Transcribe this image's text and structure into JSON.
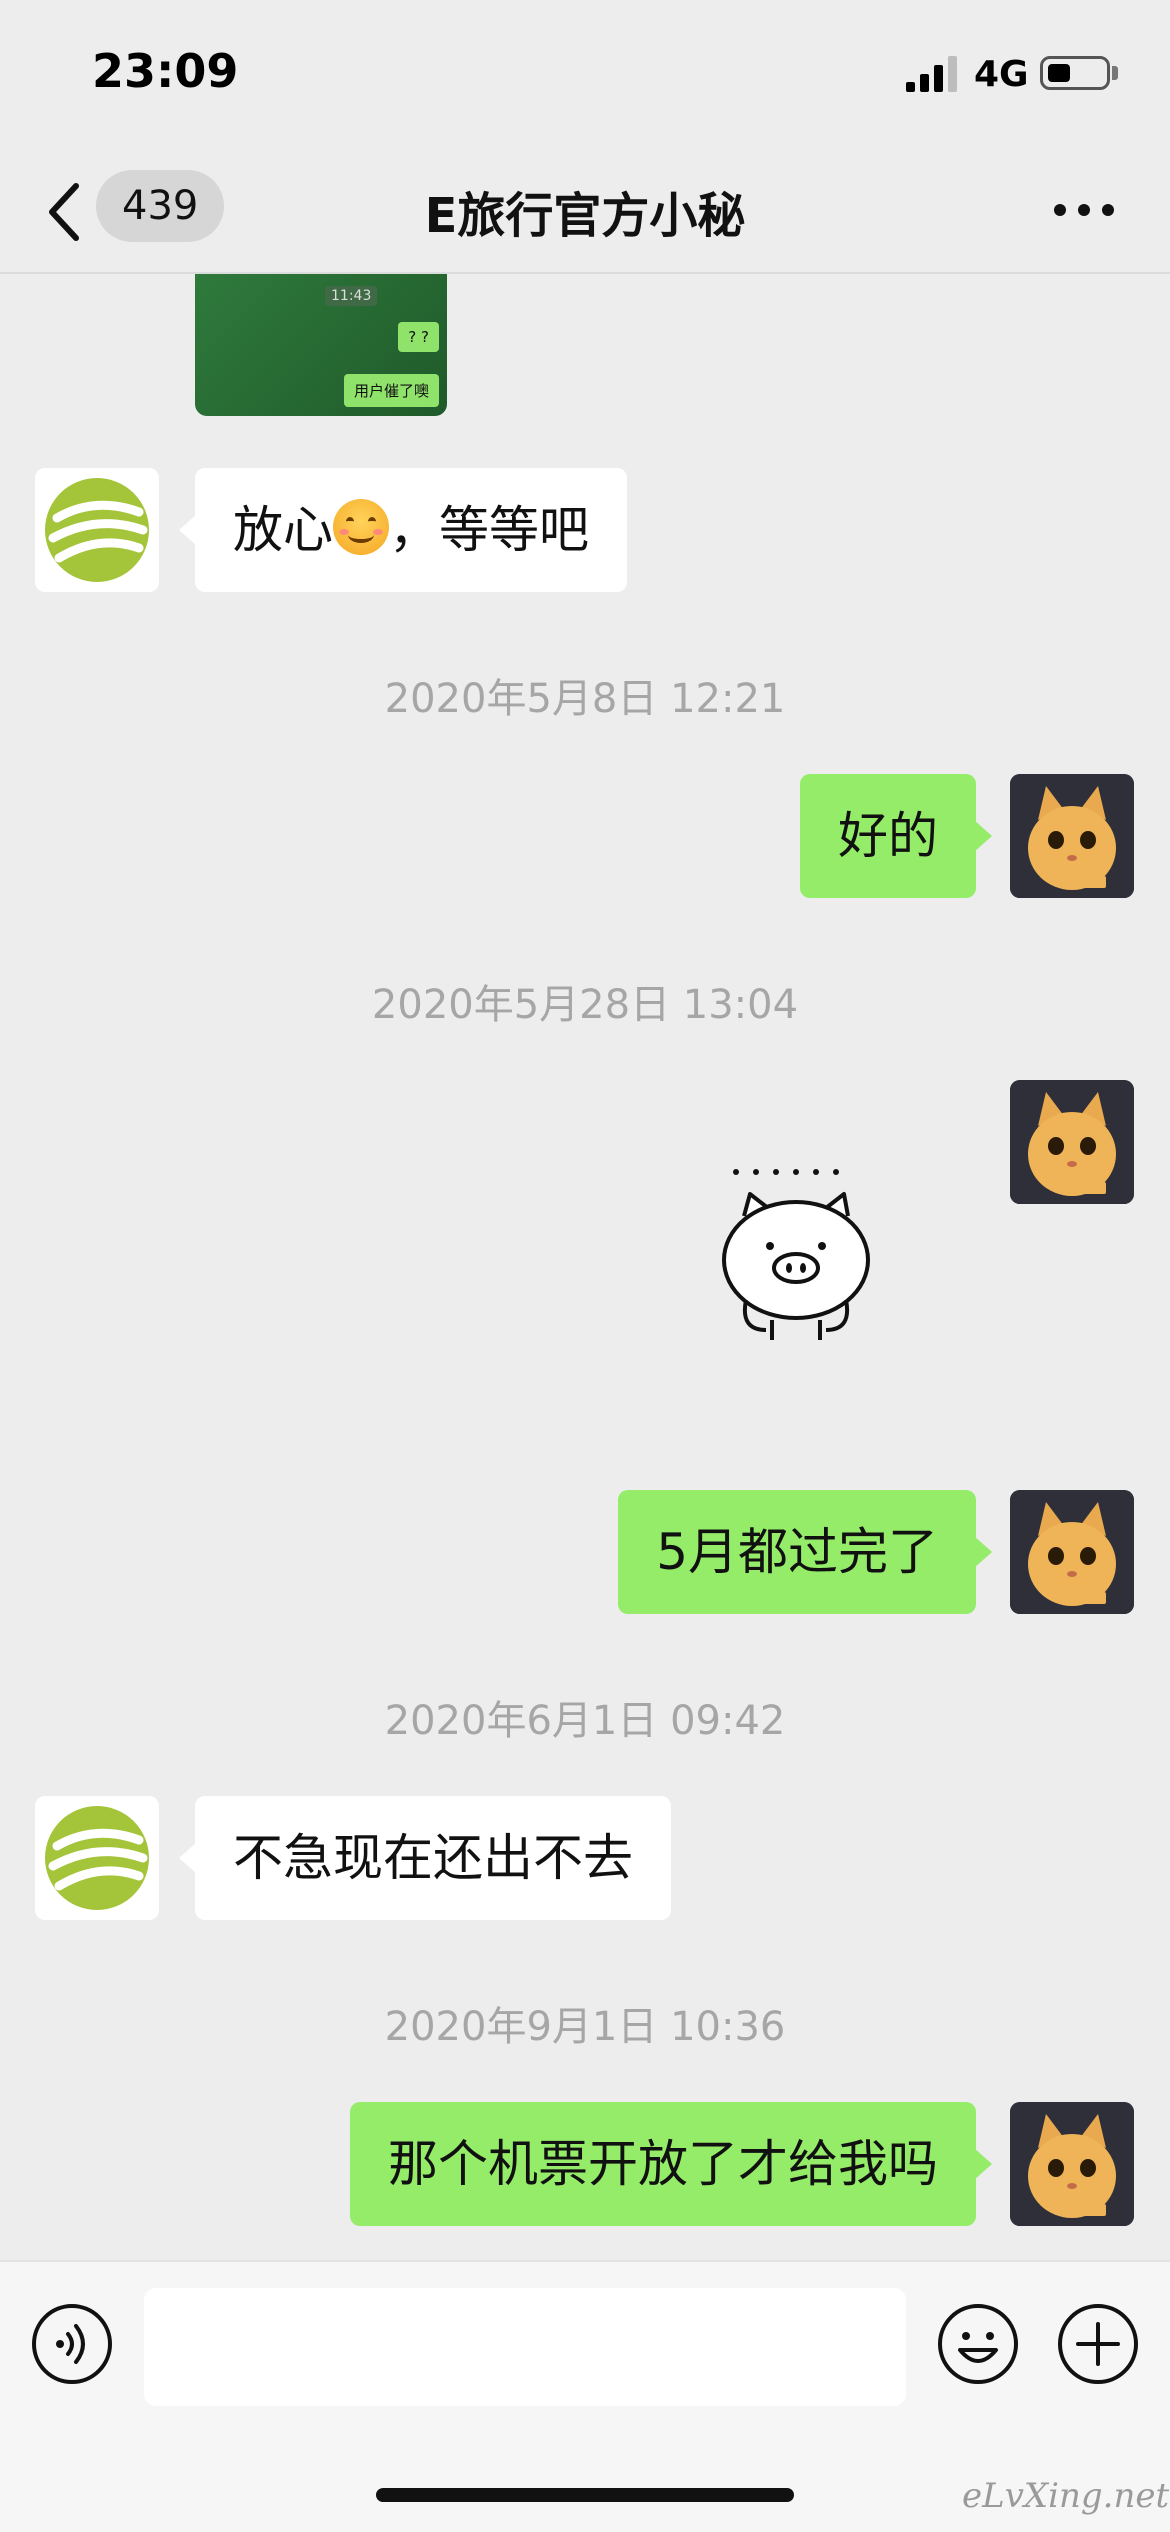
{
  "status_bar": {
    "time": "23:09",
    "network": "4G",
    "battery_percent": 35
  },
  "nav": {
    "unread_count": "439",
    "title": "E旅行官方小秘"
  },
  "image_message": {
    "time": "11:43",
    "bubble1": "? ?",
    "bubble2": "用户催了噢"
  },
  "messages": [
    {
      "side": "left",
      "text_before": "放心",
      "emoji": "smiling-face",
      "text_after": "，等等吧"
    },
    {
      "type": "timestamp",
      "text": "2020年5月8日 12:21"
    },
    {
      "side": "right",
      "text": "好的"
    },
    {
      "type": "timestamp",
      "text": "2020年5月28日 13:04"
    },
    {
      "side": "right",
      "type": "sticker",
      "sticker": "pig-sticker"
    },
    {
      "side": "right",
      "text": "5月都过完了"
    },
    {
      "type": "timestamp",
      "text": "2020年6月1日 09:42"
    },
    {
      "side": "left",
      "text": "不急现在还出不去"
    },
    {
      "type": "timestamp",
      "text": "2020年9月1日 10:36"
    },
    {
      "side": "right",
      "text": "那个机票开放了才给我吗"
    }
  ],
  "input": {
    "value": "",
    "placeholder": ""
  },
  "icons": {
    "voice": "voice-icon",
    "emoji": "emoji-icon",
    "plus": "plus-icon",
    "back": "back-chevron-icon",
    "more": "more-icon"
  },
  "colors": {
    "sent_bubble": "#95ec69",
    "received_bubble": "#ffffff",
    "background": "#ededed",
    "logo_green": "#a4c43a"
  },
  "watermark": "eLvXing.net"
}
